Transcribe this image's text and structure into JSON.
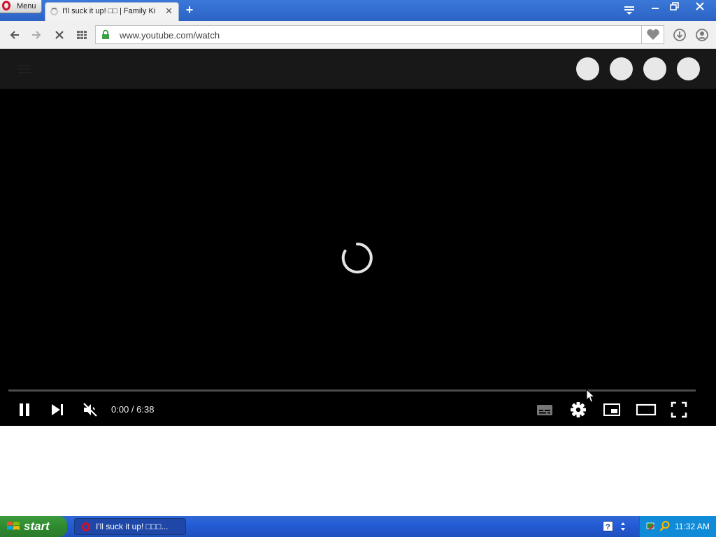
{
  "browser": {
    "menu_label": "Menu",
    "tab_title": "I'll suck it up! □□ | Family Ki",
    "url": "www.youtube.com/watch"
  },
  "player": {
    "time": "0:00 / 6:38"
  },
  "taskbar": {
    "start_label": "start",
    "task_label": "I'll suck it up! □□□...",
    "clock": "11:32 AM"
  },
  "colors": {
    "player_background": "#000000",
    "header_background": "#181818",
    "taskbar_blue": "#245dd7",
    "tray_blue": "#0f8bd8",
    "start_green": "#2f8a2f",
    "opera_red": "#d3102a",
    "lock_green": "#3aa043"
  },
  "icons": {
    "nav": [
      "back-arrow-icon",
      "forward-arrow-icon",
      "stop-loading-icon",
      "speed-dial-grid-icon",
      "secure-lock-icon",
      "heart-icon",
      "download-icon",
      "account-icon"
    ],
    "player_controls": [
      "pause-icon",
      "next-track-icon",
      "volume-muted-icon",
      "subtitles-icon",
      "settings-gear-icon",
      "miniplayer-icon",
      "theater-mode-icon",
      "fullscreen-icon"
    ]
  }
}
